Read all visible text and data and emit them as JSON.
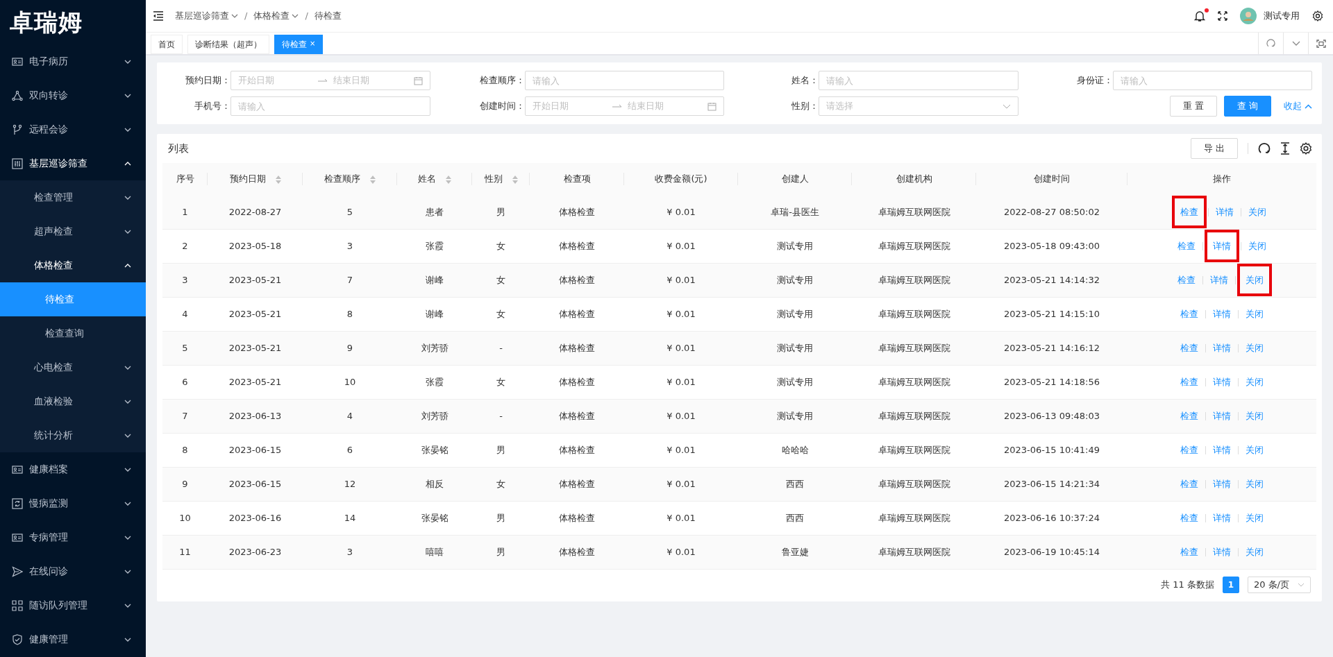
{
  "sidebar": {
    "logo": "卓瑞姆",
    "items": [
      {
        "label": "电子病历",
        "expanded": false,
        "selected": false
      },
      {
        "label": "双向转诊",
        "expanded": false,
        "selected": false
      },
      {
        "label": "远程会诊",
        "expanded": false,
        "selected": false
      },
      {
        "label": "基层巡诊筛查",
        "expanded": true,
        "selected": false,
        "children": [
          {
            "label": "检查管理",
            "expanded": false,
            "selected": false
          },
          {
            "label": "超声检查",
            "expanded": false,
            "selected": false
          },
          {
            "label": "体格检查",
            "expanded": true,
            "selected": false,
            "children": [
              {
                "label": "待检查",
                "selected": true
              },
              {
                "label": "检查查询",
                "selected": false
              }
            ]
          },
          {
            "label": "心电检查",
            "expanded": false,
            "selected": false
          },
          {
            "label": "血液检验",
            "expanded": false,
            "selected": false
          },
          {
            "label": "统计分析",
            "expanded": false,
            "selected": false
          }
        ]
      },
      {
        "label": "健康档案",
        "expanded": false,
        "selected": false
      },
      {
        "label": "慢病监测",
        "expanded": false,
        "selected": false
      },
      {
        "label": "专病管理",
        "expanded": false,
        "selected": false
      },
      {
        "label": "在线问诊",
        "expanded": false,
        "selected": false
      },
      {
        "label": "随访队列管理",
        "expanded": false,
        "selected": false
      },
      {
        "label": "健康管理",
        "expanded": false,
        "selected": false
      }
    ]
  },
  "header": {
    "breadcrumb": {
      "separator": "/",
      "items": [
        {
          "label": "基层巡诊筛查",
          "dropdown": true
        },
        {
          "label": "体格检查",
          "dropdown": true
        },
        {
          "label": "待检查",
          "dropdown": false
        }
      ]
    },
    "notification_dot": true,
    "user_name": "测试专用"
  },
  "tabs": [
    {
      "label": "首页",
      "selected": false
    },
    {
      "label": "诊断结果（超声）",
      "selected": false
    },
    {
      "label": "待检查",
      "selected": true,
      "close": "×"
    }
  ],
  "filters": {
    "fields": [
      {
        "kind": "date-range",
        "label": "预约日期：",
        "start_placeholder": "开始日期",
        "end_placeholder": "结束日期"
      },
      {
        "kind": "text",
        "label": "检查顺序：",
        "placeholder": "请输入"
      },
      {
        "kind": "text",
        "label": "姓名：",
        "placeholder": "请输入"
      },
      {
        "kind": "text",
        "label": "身份证：",
        "placeholder": "请输入"
      },
      {
        "kind": "text",
        "label": "手机号：",
        "placeholder": "请输入"
      },
      {
        "kind": "date-range",
        "label": "创建时间：",
        "start_placeholder": "开始日期",
        "end_placeholder": "结束日期"
      },
      {
        "kind": "select",
        "label": "性别：",
        "placeholder": "请选择"
      }
    ],
    "reset_button": "重 置",
    "query_button": "查 询",
    "collapse_link": "收起"
  },
  "table": {
    "title": "列表",
    "export_button": "导 出",
    "columns": [
      {
        "label": "序号",
        "sortable": false
      },
      {
        "label": "预约日期",
        "sortable": true
      },
      {
        "label": "检查顺序",
        "sortable": true
      },
      {
        "label": "姓名",
        "sortable": true
      },
      {
        "label": "性别",
        "sortable": true
      },
      {
        "label": "检查项",
        "sortable": false
      },
      {
        "label": "收费金额(元)",
        "sortable": false
      },
      {
        "label": "创建人",
        "sortable": false
      },
      {
        "label": "创建机构",
        "sortable": false
      },
      {
        "label": "创建时间",
        "sortable": false
      },
      {
        "label": "操作",
        "sortable": false
      }
    ],
    "rows": [
      {
        "cells": [
          "1",
          "2022-08-27",
          "5",
          "患者",
          "男",
          "体格检查",
          "¥ 0.01",
          "卓瑞-县医生",
          "卓瑞姆互联网医院",
          "2022-08-27 08:50:02"
        ],
        "actions": [
          {
            "label": "检查",
            "highlighted": true
          },
          {
            "label": "详情",
            "highlighted": false
          },
          {
            "label": "关闭",
            "highlighted": false
          }
        ]
      },
      {
        "cells": [
          "2",
          "2023-05-18",
          "3",
          "张霞",
          "女",
          "体格检查",
          "¥ 0.01",
          "测试专用",
          "卓瑞姆互联网医院",
          "2023-05-18 09:43:00"
        ],
        "actions": [
          {
            "label": "检查",
            "highlighted": false
          },
          {
            "label": "详情",
            "highlighted": true
          },
          {
            "label": "关闭",
            "highlighted": false
          }
        ]
      },
      {
        "cells": [
          "3",
          "2023-05-21",
          "7",
          "谢峰",
          "女",
          "体格检查",
          "¥ 0.01",
          "测试专用",
          "卓瑞姆互联网医院",
          "2023-05-21 14:14:32"
        ],
        "actions": [
          {
            "label": "检查",
            "highlighted": false
          },
          {
            "label": "详情",
            "highlighted": false
          },
          {
            "label": "关闭",
            "highlighted": true
          }
        ]
      },
      {
        "cells": [
          "4",
          "2023-05-21",
          "8",
          "谢峰",
          "女",
          "体格检查",
          "¥ 0.01",
          "测试专用",
          "卓瑞姆互联网医院",
          "2023-05-21 14:15:10"
        ],
        "actions": [
          {
            "label": "检查",
            "highlighted": false
          },
          {
            "label": "详情",
            "highlighted": false
          },
          {
            "label": "关闭",
            "highlighted": false
          }
        ]
      },
      {
        "cells": [
          "5",
          "2023-05-21",
          "9",
          "刘芳骄",
          "-",
          "体格检查",
          "¥ 0.01",
          "测试专用",
          "卓瑞姆互联网医院",
          "2023-05-21 14:16:12"
        ],
        "actions": [
          {
            "label": "检查",
            "highlighted": false
          },
          {
            "label": "详情",
            "highlighted": false
          },
          {
            "label": "关闭",
            "highlighted": false
          }
        ]
      },
      {
        "cells": [
          "6",
          "2023-05-21",
          "10",
          "张霞",
          "女",
          "体格检查",
          "¥ 0.01",
          "测试专用",
          "卓瑞姆互联网医院",
          "2023-05-21 14:18:56"
        ],
        "actions": [
          {
            "label": "检查",
            "highlighted": false
          },
          {
            "label": "详情",
            "highlighted": false
          },
          {
            "label": "关闭",
            "highlighted": false
          }
        ]
      },
      {
        "cells": [
          "7",
          "2023-06-13",
          "4",
          "刘芳骄",
          "-",
          "体格检查",
          "¥ 0.01",
          "测试专用",
          "卓瑞姆互联网医院",
          "2023-06-13 09:48:03"
        ],
        "actions": [
          {
            "label": "检查",
            "highlighted": false
          },
          {
            "label": "详情",
            "highlighted": false
          },
          {
            "label": "关闭",
            "highlighted": false
          }
        ]
      },
      {
        "cells": [
          "8",
          "2023-06-15",
          "6",
          "张晏铭",
          "男",
          "体格检查",
          "¥ 0.01",
          "哈哈哈",
          "卓瑞姆互联网医院",
          "2023-06-15 10:41:49"
        ],
        "actions": [
          {
            "label": "检查",
            "highlighted": false
          },
          {
            "label": "详情",
            "highlighted": false
          },
          {
            "label": "关闭",
            "highlighted": false
          }
        ]
      },
      {
        "cells": [
          "9",
          "2023-06-15",
          "12",
          "相反",
          "女",
          "体格检查",
          "¥ 0.01",
          "西西",
          "卓瑞姆互联网医院",
          "2023-06-15 14:21:34"
        ],
        "actions": [
          {
            "label": "检查",
            "highlighted": false
          },
          {
            "label": "详情",
            "highlighted": false
          },
          {
            "label": "关闭",
            "highlighted": false
          }
        ]
      },
      {
        "cells": [
          "10",
          "2023-06-16",
          "14",
          "张晏铭",
          "男",
          "体格检查",
          "¥ 0.01",
          "西西",
          "卓瑞姆互联网医院",
          "2023-06-16 10:37:24"
        ],
        "actions": [
          {
            "label": "检查",
            "highlighted": false
          },
          {
            "label": "详情",
            "highlighted": false
          },
          {
            "label": "关闭",
            "highlighted": false
          }
        ]
      },
      {
        "cells": [
          "11",
          "2023-06-23",
          "3",
          "嘻嘻",
          "男",
          "体格检查",
          "¥ 0.01",
          "鲁亚婕",
          "卓瑞姆互联网医院",
          "2023-06-19 10:45:14"
        ],
        "actions": [
          {
            "label": "检查",
            "highlighted": false
          },
          {
            "label": "详情",
            "highlighted": false
          },
          {
            "label": "关闭",
            "highlighted": false
          }
        ]
      }
    ]
  },
  "pagination": {
    "total": "共 11 条数据",
    "pages": [
      {
        "label": "1",
        "selected": true
      }
    ],
    "page_size": "20 条/页"
  }
}
